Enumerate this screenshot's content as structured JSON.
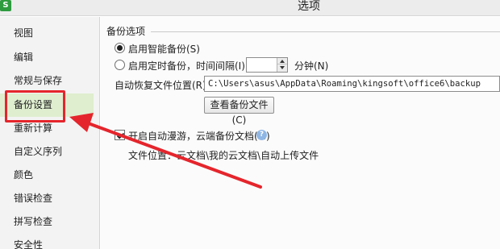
{
  "window": {
    "app_icon": "S",
    "title": "选项"
  },
  "sidebar": {
    "items": [
      {
        "label": "视图"
      },
      {
        "label": "编辑"
      },
      {
        "label": "常规与保存"
      },
      {
        "label": "备份设置",
        "selected": true
      },
      {
        "label": "重新计算"
      },
      {
        "label": "自定义序列"
      },
      {
        "label": "颜色"
      },
      {
        "label": "错误检查"
      },
      {
        "label": "拼写检查"
      },
      {
        "label": "安全性"
      }
    ]
  },
  "backup": {
    "group_title": "备份选项",
    "smart_backup_label": "启用智能备份(S)",
    "smart_backup_checked": true,
    "timed_backup_label": "启用定时备份，时间间隔(I):",
    "timed_backup_checked": false,
    "interval_value": "",
    "interval_unit": "分钟(N)",
    "recovery_location_label": "自动恢复文件位置(R):",
    "recovery_location_value": "C:\\Users\\asus\\AppData\\Roaming\\kingsoft\\office6\\backup",
    "view_backup_button": "查看备份文件(C)"
  },
  "cloud": {
    "roaming_label": "开启自动漫游，云端备份文档(M)",
    "roaming_checked": true,
    "file_location_text": "文件位置：云文档\\我的云文档\\自动上传文件"
  },
  "annotation": {
    "color": "#e5252c"
  },
  "colors": {
    "selected_bg": "#dfeecf",
    "sidebar_bg": "#f3f3f3",
    "help_icon": "#8fb7e5"
  }
}
